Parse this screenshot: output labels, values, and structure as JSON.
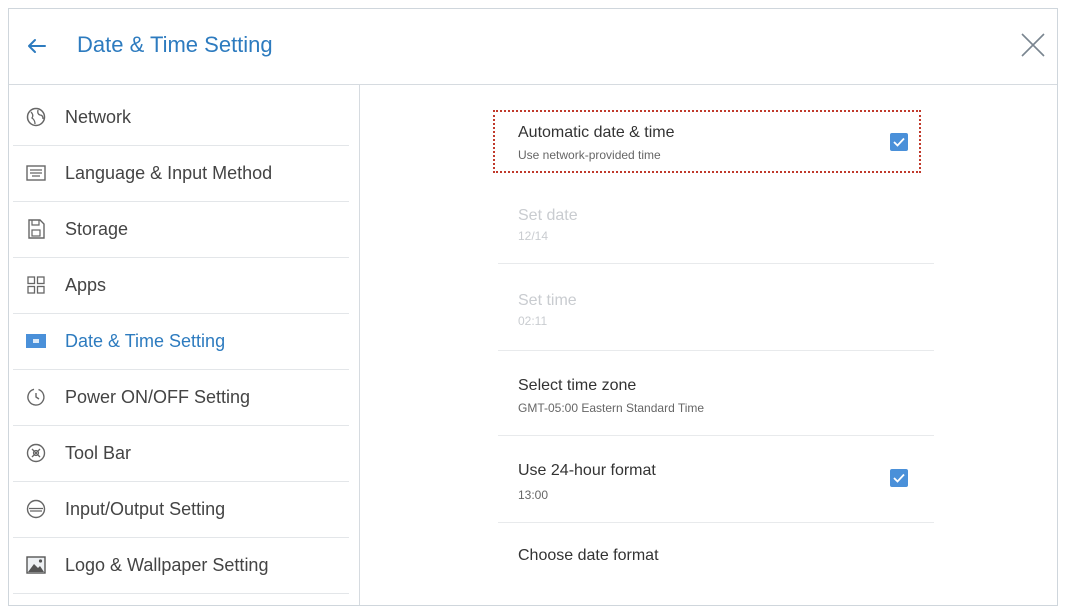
{
  "header": {
    "title": "Date & Time Setting"
  },
  "sidebar": {
    "items": [
      {
        "label": "Network",
        "icon": "globe-icon"
      },
      {
        "label": "Language & Input Method",
        "icon": "keyboard-icon"
      },
      {
        "label": "Storage",
        "icon": "storage-icon"
      },
      {
        "label": "Apps",
        "icon": "apps-grid-icon"
      },
      {
        "label": "Date & Time Setting",
        "icon": "calendar-icon",
        "active": true
      },
      {
        "label": "Power ON/OFF Setting",
        "icon": "power-timer-icon"
      },
      {
        "label": "Tool Bar",
        "icon": "toolbar-icon"
      },
      {
        "label": "Input/Output Setting",
        "icon": "input-output-icon"
      },
      {
        "label": "Logo & Wallpaper Setting",
        "icon": "wallpaper-icon"
      }
    ]
  },
  "settings": {
    "automatic": {
      "title": "Automatic date & time",
      "subtitle": "Use network-provided time",
      "checked": true
    },
    "set_date": {
      "title": "Set date",
      "value": "12/14"
    },
    "set_time": {
      "title": "Set time",
      "value": "02:11"
    },
    "time_zone": {
      "title": "Select time zone",
      "value": "GMT-05:00 Eastern Standard Time"
    },
    "hour24": {
      "title": "Use 24-hour format",
      "value": "13:00",
      "checked": true
    },
    "date_format": {
      "title": "Choose date format"
    }
  },
  "colors": {
    "accent": "#2d7bbf",
    "checkbox": "#4a90d9",
    "highlight_border": "#c0392b"
  }
}
